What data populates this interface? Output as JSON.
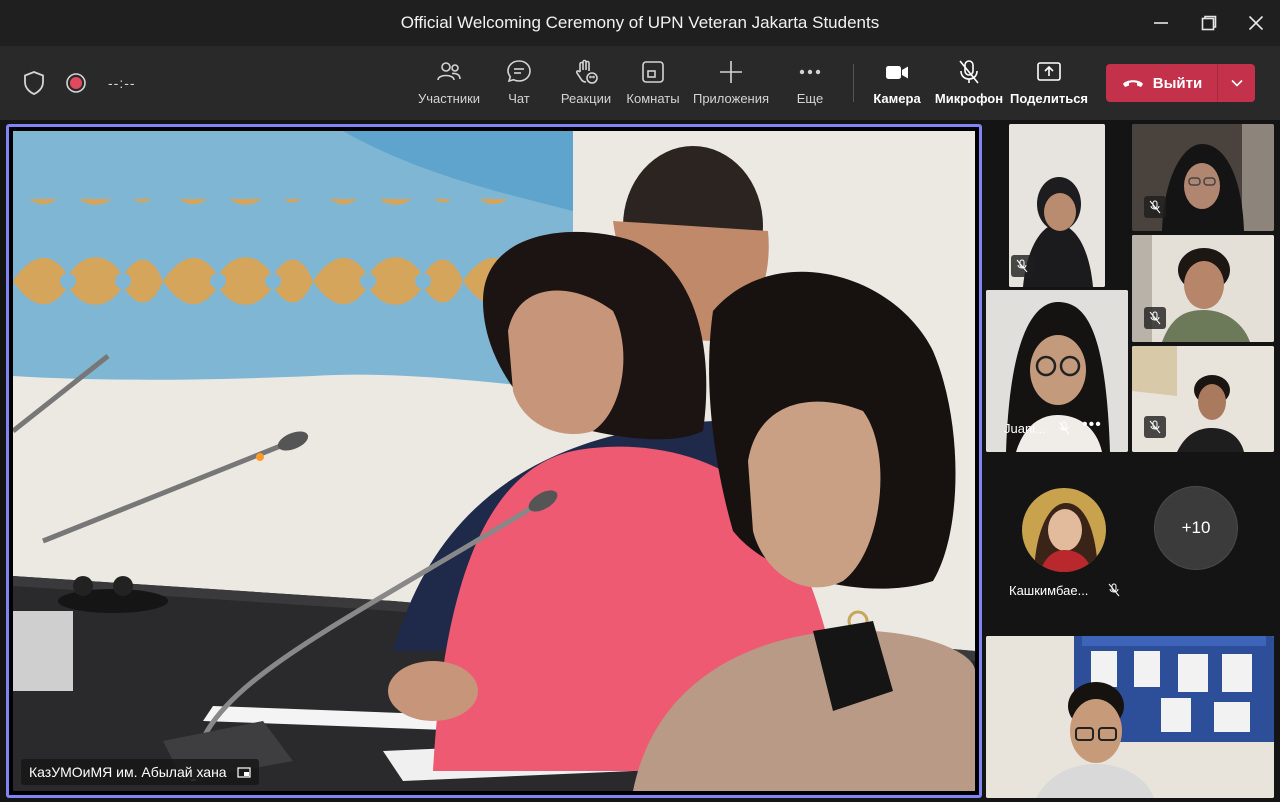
{
  "window": {
    "title": "Official Welcoming Ceremony of UPN Veteran Jakarta Students"
  },
  "toolbar": {
    "timer": "--:--",
    "tools": {
      "participants": "Участники",
      "chat": "Чат",
      "reactions": "Реакции",
      "rooms": "Комнаты",
      "apps": "Приложения",
      "more": "Еще",
      "camera": "Камера",
      "mic": "Микрофон",
      "share": "Поделиться"
    },
    "leave_label": "Выйти"
  },
  "stage": {
    "speaker_name": "КазУМОиМЯ им. Абылай хана"
  },
  "participants": {
    "juani_name": "Juani...",
    "kashkimbaeva_name": "Кашкимбае...",
    "overflow_count": "+10"
  },
  "colors": {
    "accent": "#7f85f5",
    "leave": "#c4314b",
    "toolbar": "#292929",
    "titlebar": "#1f1f1f"
  }
}
